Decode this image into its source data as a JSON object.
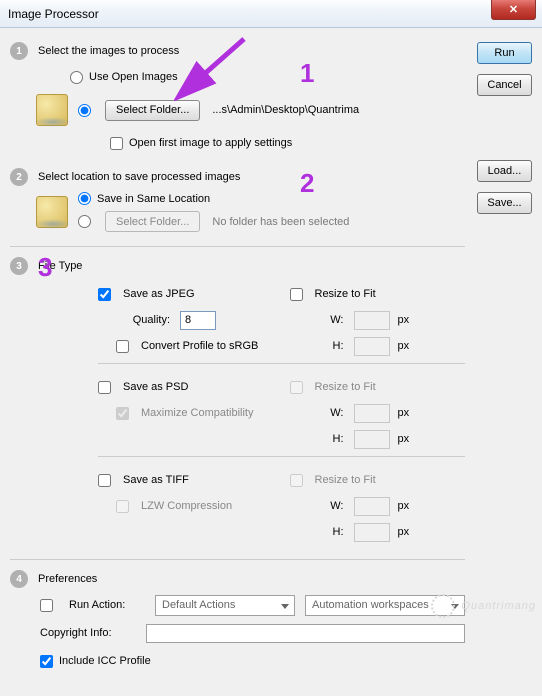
{
  "window": {
    "title": "Image Processor"
  },
  "buttons": {
    "run": "Run",
    "cancel": "Cancel",
    "load": "Load...",
    "save": "Save...",
    "select_folder": "Select Folder..."
  },
  "sec1": {
    "num": "1",
    "title": "Select the images to process",
    "use_open": "Use Open Images",
    "path": "...s\\Admin\\Desktop\\Quantrima",
    "open_first": "Open first image to apply settings"
  },
  "sec2": {
    "num": "2",
    "title": "Select location to save processed images",
    "same_loc": "Save in Same Location",
    "no_folder": "No folder has been selected"
  },
  "sec3": {
    "num": "3",
    "title": "File Type",
    "jpeg": "Save as JPEG",
    "quality_label": "Quality:",
    "quality_val": "8",
    "convert": "Convert Profile to sRGB",
    "resize": "Resize to Fit",
    "w": "W:",
    "h": "H:",
    "px": "px",
    "psd": "Save as PSD",
    "maxcompat": "Maximize Compatibility",
    "tiff": "Save as TIFF",
    "lzw": "LZW Compression"
  },
  "sec4": {
    "num": "4",
    "title": "Preferences",
    "run_action": "Run Action:",
    "action_set": "Default Actions",
    "action": "Automation workspaces",
    "copyright": "Copyright Info:",
    "icc": "Include ICC Profile"
  },
  "annot": {
    "a1": "1",
    "a2": "2",
    "a3": "3"
  },
  "watermark": "Quantrimang"
}
